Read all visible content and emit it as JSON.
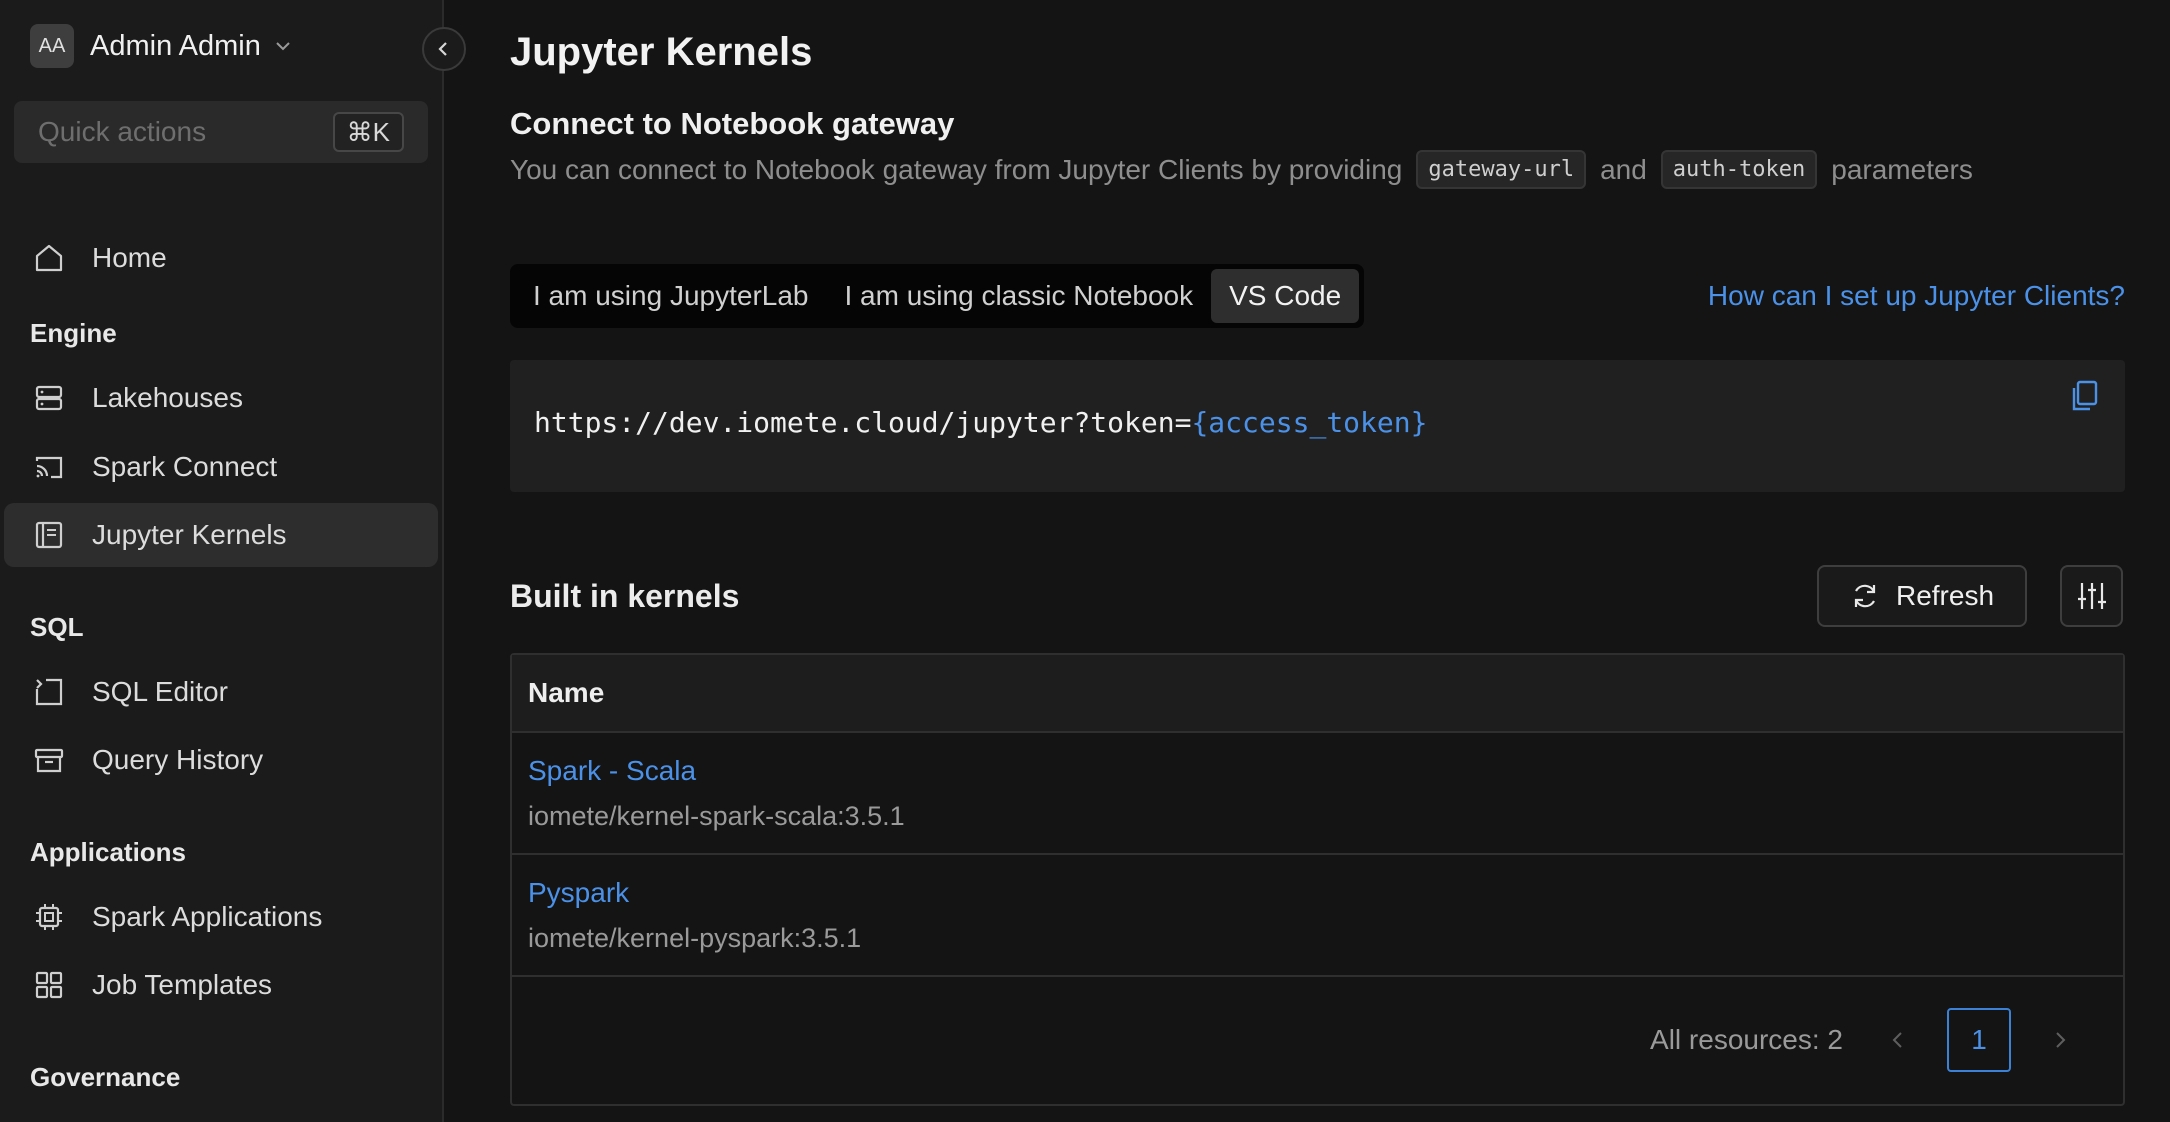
{
  "sidebar": {
    "user": {
      "initials": "AA",
      "name": "Admin Admin"
    },
    "quick_actions": {
      "placeholder": "Quick actions",
      "shortcut": "⌘K"
    },
    "home": "Home",
    "sections": [
      {
        "title": "Engine",
        "items": [
          "Lakehouses",
          "Spark Connect",
          "Jupyter Kernels"
        ]
      },
      {
        "title": "SQL",
        "items": [
          "SQL Editor",
          "Query History"
        ]
      },
      {
        "title": "Applications",
        "items": [
          "Spark Applications",
          "Job Templates"
        ]
      },
      {
        "title": "Governance",
        "items": []
      }
    ],
    "active_item": "Jupyter Kernels"
  },
  "main": {
    "title": "Jupyter Kernels",
    "gateway": {
      "title": "Connect to Notebook gateway",
      "desc_before": "You can connect to Notebook gateway from Jupyter Clients by providing",
      "chip_1": "gateway-url",
      "desc_and": "and",
      "chip_2": "auth-token",
      "desc_after": "parameters"
    },
    "tabs": [
      "I am using JupyterLab",
      "I am using classic Notebook",
      "VS Code"
    ],
    "active_tab": "VS Code",
    "help_link": "How can I set up Jupyter Clients?",
    "url": {
      "base": "https://dev.iomete.cloud/jupyter?token=",
      "token": "{access_token}"
    },
    "kernels": {
      "title": "Built in kernels",
      "refresh_label": "Refresh",
      "column_name": "Name",
      "rows": [
        {
          "name": "Spark - Scala",
          "image": "iomete/kernel-spark-scala:3.5.1"
        },
        {
          "name": "Pyspark",
          "image": "iomete/kernel-pyspark:3.5.1"
        }
      ],
      "total_label": "All resources: 2",
      "current_page": "1"
    }
  },
  "colors": {
    "accent": "#4b91e8",
    "background": "#141414",
    "sidebar": "#1b1b1b"
  }
}
